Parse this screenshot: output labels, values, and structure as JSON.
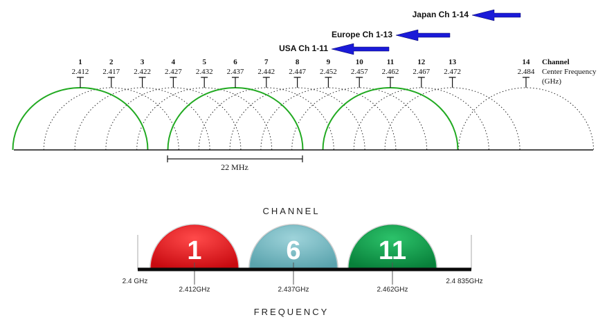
{
  "regions": [
    {
      "label": "Japan Ch 1-14",
      "arrow_color": "#1010c8"
    },
    {
      "label": "Europe Ch 1-13",
      "arrow_color": "#1010c8"
    },
    {
      "label": "USA Ch 1-11",
      "arrow_color": "#1010c8"
    }
  ],
  "spectrum": {
    "channel_header": "Channel",
    "freq_header": "Center Frequency",
    "freq_unit": "(GHz)",
    "channels": [
      {
        "number": "1",
        "freq": "2.412"
      },
      {
        "number": "2",
        "freq": "2.417"
      },
      {
        "number": "3",
        "freq": "2.422"
      },
      {
        "number": "4",
        "freq": "2.427"
      },
      {
        "number": "5",
        "freq": "2.432"
      },
      {
        "number": "6",
        "freq": "2.437"
      },
      {
        "number": "7",
        "freq": "2.442"
      },
      {
        "number": "8",
        "freq": "2.447"
      },
      {
        "number": "9",
        "freq": "2.452"
      },
      {
        "number": "10",
        "freq": "2.457"
      },
      {
        "number": "11",
        "freq": "2.462"
      },
      {
        "number": "12",
        "freq": "2.467"
      },
      {
        "number": "13",
        "freq": "2.472"
      },
      {
        "number": "14",
        "freq": "2.484"
      }
    ],
    "non_overlapping": [
      "1",
      "6",
      "11"
    ],
    "width_label": "22 MHz",
    "overlap_color": "#222222",
    "highlight_color": "#22aa22"
  },
  "bottom": {
    "top_label": "CHANNEL",
    "bottom_label": "FREQUENCY",
    "left_edge": "2.4 GHz",
    "right_edge": "2.4 835GHz",
    "domes": [
      {
        "number": "1",
        "freq": "2.412GHz",
        "color": "#e8141c"
      },
      {
        "number": "6",
        "freq": "2.437GHz",
        "color": "#6fb3bd"
      },
      {
        "number": "11",
        "freq": "2.462GHz",
        "color": "#0e9a48"
      }
    ]
  }
}
